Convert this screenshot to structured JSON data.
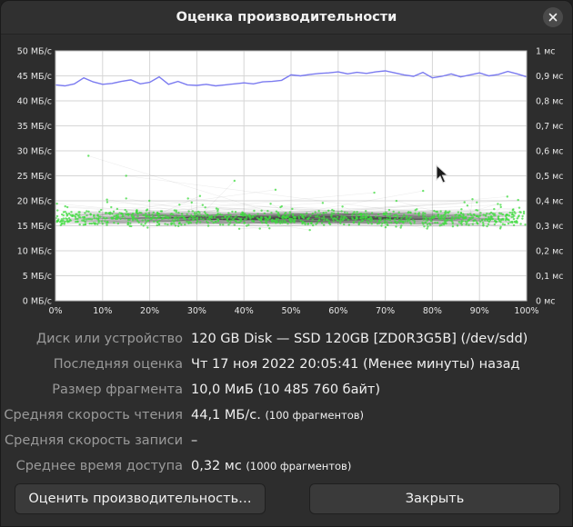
{
  "window": {
    "title": "Оценка производительности"
  },
  "chart_data": {
    "type": "line",
    "x_ticks": [
      "0%",
      "10%",
      "20%",
      "30%",
      "40%",
      "50%",
      "60%",
      "70%",
      "80%",
      "90%",
      "100%"
    ],
    "y_left_ticks": [
      "0 МБ/с",
      "5 МБ/с",
      "10 МБ/с",
      "15 МБ/с",
      "20 МБ/с",
      "25 МБ/с",
      "30 МБ/с",
      "35 МБ/с",
      "40 МБ/с",
      "45 МБ/с",
      "50 МБ/с"
    ],
    "y_right_ticks": [
      "0 мс",
      "0,1 мс",
      "0,2 мс",
      "0,3 мс",
      "0,4 мс",
      "0,5 мс",
      "0,6 мс",
      "0,7 мс",
      "0,8 мс",
      "0,9 мс",
      "1 мс"
    ],
    "xlim": [
      0,
      100
    ],
    "ylim_left": [
      0,
      50
    ],
    "ylim_right": [
      0,
      1
    ],
    "grid": true,
    "series": [
      {
        "color": "#7b7bf0",
        "axis": "left",
        "x": [
          0,
          2,
          4,
          6,
          8,
          10,
          12,
          14,
          16,
          18,
          20,
          22,
          24,
          26,
          28,
          30,
          32,
          34,
          36,
          38,
          40,
          42,
          44,
          46,
          48,
          50,
          52,
          54,
          56,
          58,
          60,
          62,
          64,
          66,
          68,
          70,
          72,
          74,
          76,
          78,
          80,
          82,
          84,
          86,
          88,
          90,
          92,
          94,
          96,
          98,
          100
        ],
        "values": [
          43.2,
          43.0,
          43.4,
          44.6,
          43.8,
          43.3,
          43.5,
          43.9,
          44.2,
          43.4,
          43.7,
          44.8,
          43.3,
          43.9,
          43.2,
          43.1,
          43.3,
          43.0,
          43.2,
          43.4,
          43.6,
          43.4,
          43.8,
          43.9,
          44.1,
          45.2,
          45.0,
          45.3,
          45.5,
          45.6,
          45.8,
          45.4,
          45.7,
          45.5,
          45.8,
          46.0,
          45.6,
          45.2,
          44.9,
          45.7,
          44.6,
          44.9,
          45.4,
          44.8,
          45.2,
          45.6,
          45.0,
          45.3,
          45.9,
          45.4,
          44.8
        ]
      },
      {
        "color": "#3ddc3d",
        "axis": "right",
        "kind": "access-time-points",
        "count": 1000,
        "typical_range_ms": [
          0.28,
          0.38
        ],
        "outliers_ms": [
          0.58,
          0.5,
          0.48
        ]
      }
    ]
  },
  "info": {
    "rows": [
      {
        "key": "Диск или устройство",
        "value": "120 GB Disk — SSD 120GB [ZD0R3G5B] (/dev/sdd)",
        "note": ""
      },
      {
        "key": "Последняя оценка",
        "value": "Чт 17 ноя 2022 20:05:41 (Менее минуты) назад",
        "note": ""
      },
      {
        "key": "Размер фрагмента",
        "value": "10,0 МиБ (10 485 760 байт)",
        "note": ""
      },
      {
        "key": "Средняя скорость чтения",
        "value": "44,1 МБ/с.",
        "note": "(100 фрагментов)"
      },
      {
        "key": "Средняя скорость записи",
        "value": "–",
        "note": ""
      },
      {
        "key": "Среднее время доступа",
        "value": "0,32 мс",
        "note": "(1000 фрагментов)"
      }
    ]
  },
  "buttons": {
    "benchmark": "Оценить производительность…",
    "close": "Закрыть"
  },
  "colors": {
    "read_line": "#7b7bf0",
    "access_points": "#3ddc3d",
    "plot_bg": "#ffffff",
    "window_bg": "#2d2d2d"
  }
}
